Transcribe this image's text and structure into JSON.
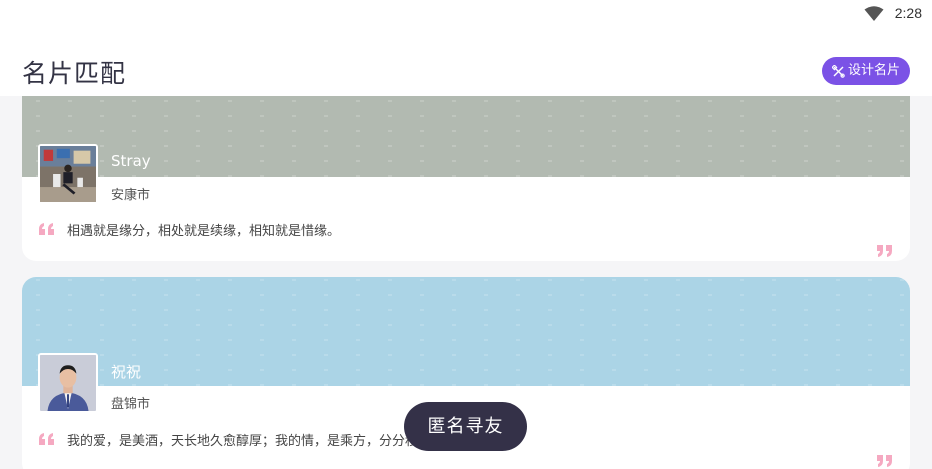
{
  "status_bar": {
    "time": "2:28",
    "wifi_icon": "wifi-icon"
  },
  "header": {
    "title": "名片匹配",
    "design_button": {
      "label": "设计名片",
      "icon": "tools-icon",
      "color": "#7b52e6"
    }
  },
  "cards": [
    {
      "name": "Stray",
      "city": "安康市",
      "quote": "相遇就是缘分，相处就是续缘，相知就是惜缘。",
      "banner_color": "#b2bab1",
      "avatar": "person-sitting-outdoors"
    },
    {
      "name": "祝祝",
      "city": "盘锦市",
      "quote": "我的爱，是美酒，天长地久愈醇厚；我的情，是乘方，分分秒",
      "banner_color": "#abd4e6",
      "avatar": "man-in-suit-portrait"
    }
  ],
  "fab": {
    "label": "匿名寻友",
    "color": "#343148"
  },
  "accent": {
    "quote_mark_color": "#f5a9c1"
  }
}
